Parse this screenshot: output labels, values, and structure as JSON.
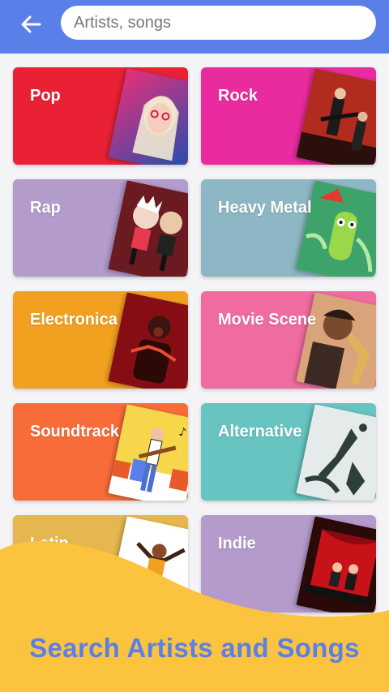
{
  "search": {
    "placeholder": "Artists, songs"
  },
  "icons": {
    "back": "arrow-left-icon"
  },
  "colors": {
    "topbar": "#5b7fe8",
    "wave": "#fcc33e",
    "banner_text": "#5b7fe8"
  },
  "genres": [
    {
      "label": "Pop",
      "color": "#ea2135"
    },
    {
      "label": "Rock",
      "color": "#ea2b9f"
    },
    {
      "label": "Rap",
      "color": "#b39bcb"
    },
    {
      "label": "Heavy Metal",
      "color": "#8db7c4"
    },
    {
      "label": "Electronica",
      "color": "#f2a020"
    },
    {
      "label": "Movie Scene",
      "color": "#f06b9f"
    },
    {
      "label": "Soundtrack",
      "color": "#f86c39"
    },
    {
      "label": "Alternative",
      "color": "#67c4c0"
    },
    {
      "label": "Latin",
      "color": "#e6b74e"
    },
    {
      "label": "Indie",
      "color": "#b49bcc"
    }
  ],
  "banner": {
    "text": "Search Artists and Songs"
  }
}
